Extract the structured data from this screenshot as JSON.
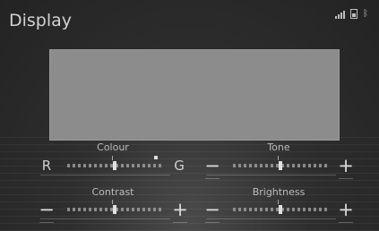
{
  "header": {
    "title": "Display"
  },
  "status_icons": [
    "signal-icon",
    "battery-icon",
    "bluetooth-icon"
  ],
  "controls": {
    "colour": {
      "label": "Colour",
      "left": "R",
      "right": "G",
      "level": 0.5
    },
    "tone": {
      "label": "Tone",
      "left": "−",
      "right": "+",
      "level": 0.5
    },
    "contrast": {
      "label": "Contrast",
      "left": "−",
      "right": "+",
      "level": 0.5
    },
    "brightness": {
      "label": "Brightness",
      "left": "−",
      "right": "+",
      "level": 0.5
    }
  },
  "colors": {
    "background": "#2a2a2a",
    "preview": "#8c8c8c",
    "text": "#d2d2d2"
  }
}
